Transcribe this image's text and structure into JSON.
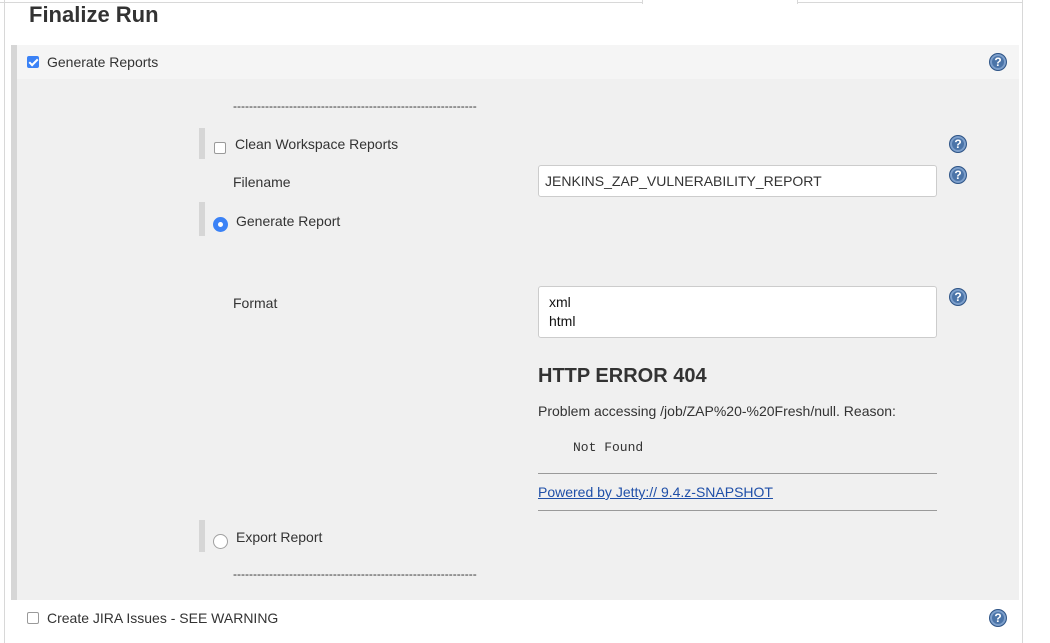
{
  "section": {
    "title": "Finalize Run"
  },
  "generate_reports": {
    "label": "Generate Reports",
    "checked": true
  },
  "clean_workspace": {
    "label": "Clean Workspace Reports",
    "checked": false
  },
  "filename": {
    "label": "Filename",
    "value": "JENKINS_ZAP_VULNERABILITY_REPORT"
  },
  "generate_report": {
    "label": "Generate Report",
    "selected": true
  },
  "format": {
    "label": "Format",
    "options": [
      "xml",
      "html"
    ]
  },
  "error": {
    "title": "HTTP ERROR 404",
    "message": "Problem accessing /job/ZAP%20-%20Fresh/null. Reason:",
    "reason": "Not Found",
    "link_text": "Powered by Jetty:// 9.4.z-SNAPSHOT"
  },
  "export_report": {
    "label": "Export Report",
    "selected": false
  },
  "create_jira": {
    "label": "Create JIRA Issues - SEE WARNING",
    "checked": false
  },
  "separator": "-------------------------------------------------------------",
  "help_glyph": "?",
  "colors": {
    "accent": "#3b82f6",
    "help": "#4b74a8",
    "link": "#1f4fa8",
    "panel": "#f0f0f0"
  }
}
